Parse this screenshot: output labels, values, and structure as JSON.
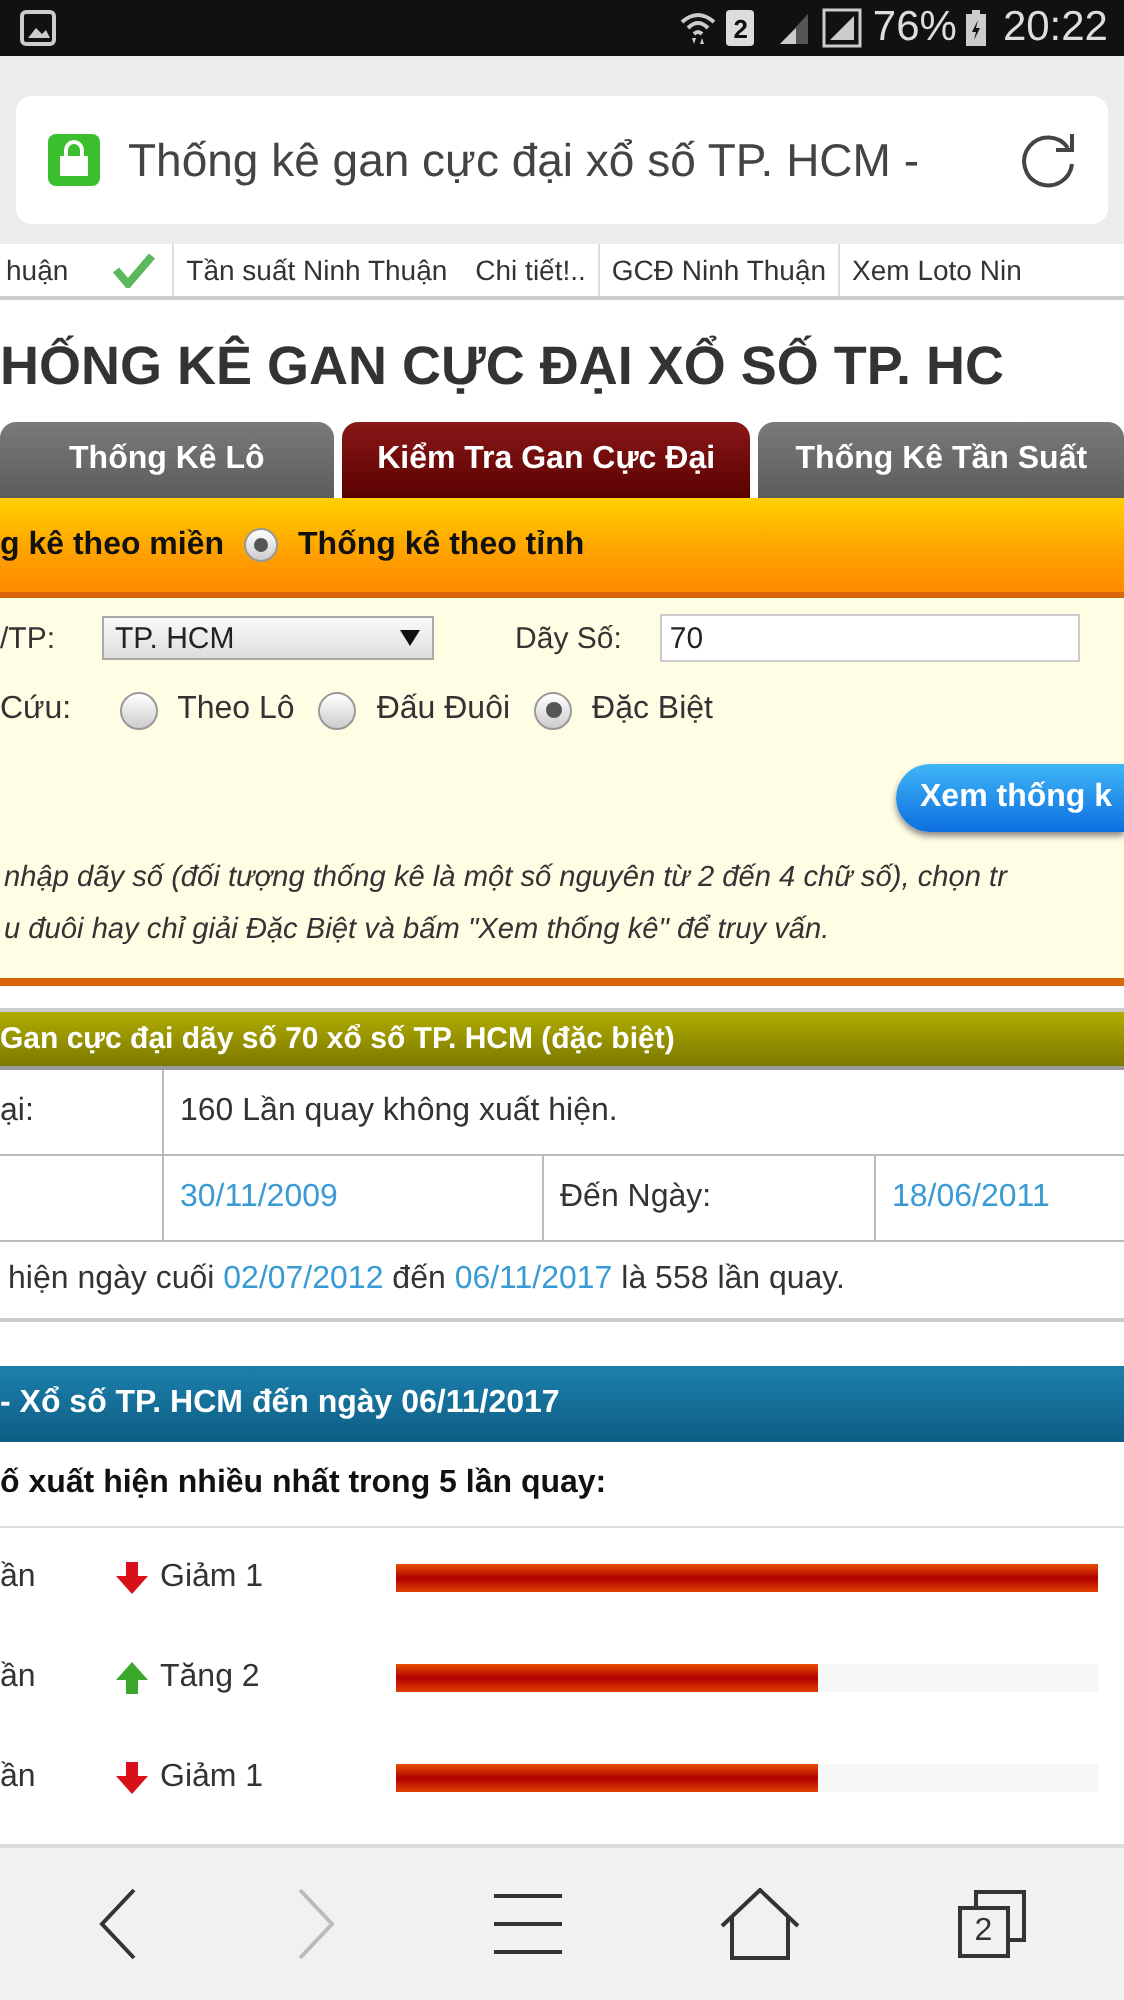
{
  "status_bar": {
    "sim": "2",
    "battery": "76%",
    "time": "20:22"
  },
  "address_bar": {
    "title": "Thống kê gan cực đại xổ số TP. HCM -"
  },
  "top_links": [
    {
      "links": [
        "huận"
      ],
      "check": true
    },
    {
      "links": [
        "Tần suất Ninh Thuận",
        "Chi tiết!.."
      ],
      "check": false
    },
    {
      "links": [
        "GCĐ Ninh Thuận"
      ],
      "check": false
    },
    {
      "links": [
        "Xem Loto Nin"
      ],
      "check": false
    }
  ],
  "heading": "HỐNG KÊ GAN CỰC ĐẠI XỔ SỐ TP. HC",
  "tabs": [
    {
      "label": "Thống Kê Lô",
      "selected": false
    },
    {
      "label": "Kiểm Tra Gan Cực Đại",
      "selected": true
    },
    {
      "label": "Thống Kê Tần Suất",
      "selected": false
    }
  ],
  "scope_options": [
    {
      "label": "g kê theo miền"
    },
    {
      "label": "Thống kê theo tỉnh",
      "selected": true
    }
  ],
  "form": {
    "province_label": "/TP:",
    "province": "TP. HCM",
    "sequence_label": "Dãy Số:",
    "sequence": "70",
    "mode_label": "Cứu:",
    "modes": [
      {
        "label": "Theo Lô",
        "selected": false
      },
      {
        "label": "Đấu Đuôi",
        "selected": false
      },
      {
        "label": "Đặc Biệt",
        "selected": true
      }
    ],
    "submit": "Xem thống k",
    "note_lines": [
      "nhập dãy số (đối tượng thống kê là một số nguyên từ 2 đến 4 chữ số), chọn tr",
      "u đuôi hay chỉ giải Đặc Biệt và bấm \"Xem thống kê\" để truy vấn."
    ]
  },
  "result": {
    "title": "Gan cực đại dãy số 70 xổ số TP. HCM (đặc biệt)",
    "max_label": "ại:",
    "max_value": "160 Lần quay không xuất hiện.",
    "from": "30/11/2009",
    "to_label": "Đến Ngày:",
    "to": "18/06/2011",
    "summary": [
      {
        "kind": "text",
        "text": "hiện ngày cuối "
      },
      {
        "kind": "link",
        "text": "02/07/2012"
      },
      {
        "kind": "text",
        "text": " đến "
      },
      {
        "kind": "link",
        "text": "06/11/2017"
      },
      {
        "kind": "text",
        "text": " là 558 lần quay."
      }
    ]
  },
  "trend": {
    "title": "- Xổ số TP. HCM đến ngày 06/11/2017",
    "subtitle": "ố xuất hiện nhiều nhất trong 5 lần quay:",
    "rows": [
      {
        "count": "ần",
        "kind": "down",
        "change": "Giảm 1",
        "level": 1
      },
      {
        "count": "ần",
        "kind": "up",
        "change": "Tăng 2",
        "level": 0.6
      },
      {
        "count": "ần",
        "kind": "down",
        "change": "Giảm 1",
        "level": 0.6
      }
    ]
  },
  "bottom_nav": {
    "tab_count": "2",
    "forward_disabled": true
  }
}
